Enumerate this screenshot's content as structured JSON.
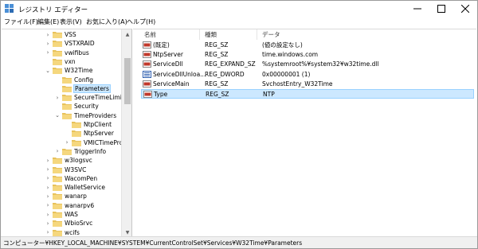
{
  "window": {
    "title": "レジストリ エディター",
    "minimize_icon": "minimize-icon",
    "maximize_icon": "maximize-icon",
    "close_icon": "close-icon"
  },
  "menu": {
    "items": [
      {
        "label": "ファイル(F)"
      },
      {
        "label": "編集(E)"
      },
      {
        "label": "表示(V)"
      },
      {
        "label": "お気に入り(A)"
      },
      {
        "label": "ヘルプ(H)"
      }
    ]
  },
  "tree": {
    "items": [
      {
        "label": "VSS",
        "expander": "›",
        "expanded": false
      },
      {
        "label": "VSTXRAID",
        "expander": "›",
        "expanded": false
      },
      {
        "label": "vwifibus",
        "expander": "›",
        "expanded": false
      },
      {
        "label": "vxn",
        "expander": "",
        "expanded": false
      },
      {
        "label": "W32Time",
        "expander": "⌄",
        "expanded": true
      },
      {
        "label": "Config",
        "expander": "",
        "expanded": false
      },
      {
        "label": "Parameters",
        "expander": "",
        "expanded": false,
        "selected": true
      },
      {
        "label": "SecureTimeLimits",
        "expander": "›",
        "expanded": false
      },
      {
        "label": "Security",
        "expander": "",
        "expanded": false
      },
      {
        "label": "TimeProviders",
        "expander": "⌄",
        "expanded": true
      },
      {
        "label": "NtpClient",
        "expander": "",
        "expanded": false
      },
      {
        "label": "NtpServer",
        "expander": "",
        "expanded": false
      },
      {
        "label": "VMICTimeProvic",
        "expander": "›",
        "expanded": false
      },
      {
        "label": "TriggerInfo",
        "expander": "›",
        "expanded": false
      },
      {
        "label": "w3logsvc",
        "expander": "›",
        "expanded": false
      },
      {
        "label": "W3SVC",
        "expander": "›",
        "expanded": false
      },
      {
        "label": "WacomPen",
        "expander": "›",
        "expanded": false
      },
      {
        "label": "WalletService",
        "expander": "›",
        "expanded": false
      },
      {
        "label": "wanarp",
        "expander": "›",
        "expanded": false
      },
      {
        "label": "wanarpv6",
        "expander": "›",
        "expanded": false
      },
      {
        "label": "WAS",
        "expander": "›",
        "expanded": false
      },
      {
        "label": "WbioSrvc",
        "expander": "›",
        "expanded": false
      },
      {
        "label": "wcifs",
        "expander": "›",
        "expanded": false
      }
    ]
  },
  "list": {
    "columns": {
      "name": "名前",
      "type": "種類",
      "data": "データ"
    },
    "rows": [
      {
        "icon": "string-value-icon",
        "name": "(既定)",
        "type": "REG_SZ",
        "data": "(値の設定なし)"
      },
      {
        "icon": "string-value-icon",
        "name": "NtpServer",
        "type": "REG_SZ",
        "data": "time.windows.com"
      },
      {
        "icon": "string-value-icon",
        "name": "ServiceDll",
        "type": "REG_EXPAND_SZ",
        "data": "%systemroot%¥system32¥w32time.dll"
      },
      {
        "icon": "binary-value-icon",
        "name": "ServiceDllUnloa...",
        "type": "REG_DWORD",
        "data": "0x00000001 (1)"
      },
      {
        "icon": "string-value-icon",
        "name": "ServiceMain",
        "type": "REG_SZ",
        "data": "SvchostEntry_W32Time"
      },
      {
        "icon": "string-value-icon",
        "name": "Type",
        "type": "REG_SZ",
        "data": "NTP",
        "selected": true
      }
    ]
  },
  "status": {
    "path": "コンピューター¥HKEY_LOCAL_MACHINE¥SYSTEM¥CurrentControlSet¥Services¥W32Time¥Parameters"
  },
  "colors": {
    "folder": "#e8c25b",
    "selection_fill": "#cce8ff",
    "selection_border": "#99d1ff",
    "string_icon": "#c0392b",
    "binary_icon": "#2e5fb0"
  }
}
